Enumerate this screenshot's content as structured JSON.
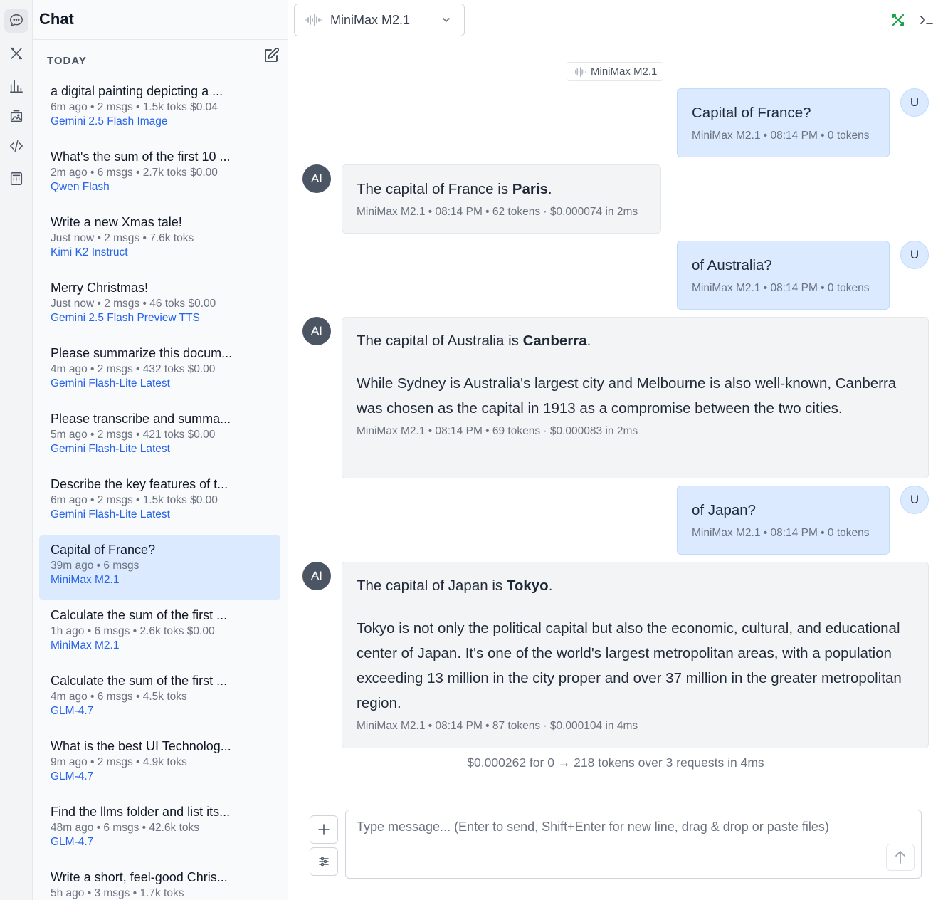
{
  "rail": {
    "items": [
      "chat-icon",
      "tools-icon",
      "bar-chart-icon",
      "image-gallery-icon",
      "code-icon",
      "calculator-icon"
    ]
  },
  "sidebar": {
    "title": "Chat",
    "section": "TODAY",
    "conversations": [
      {
        "title": "a digital painting depicting a ...",
        "meta": "6m ago • 2 msgs • 1.5k toks $0.04",
        "model": "Gemini 2.5 Flash Image"
      },
      {
        "title": "What's the sum of the first 10 ...",
        "meta": "2m ago • 6 msgs • 2.7k toks $0.00",
        "model": "Qwen Flash"
      },
      {
        "title": "Write a new Xmas tale!",
        "meta": "Just now • 2 msgs • 7.6k toks",
        "model": "Kimi K2 Instruct"
      },
      {
        "title": "Merry Christmas!",
        "meta": "Just now • 2 msgs • 46 toks $0.00",
        "model": "Gemini 2.5 Flash Preview TTS"
      },
      {
        "title": "Please summarize this docum...",
        "meta": "4m ago • 2 msgs • 432 toks $0.00",
        "model": "Gemini Flash-Lite Latest"
      },
      {
        "title": "Please transcribe and summa...",
        "meta": "5m ago • 2 msgs • 421 toks $0.00",
        "model": "Gemini Flash-Lite Latest"
      },
      {
        "title": "Describe the key features of t...",
        "meta": "6m ago • 2 msgs • 1.5k toks $0.00",
        "model": "Gemini Flash-Lite Latest"
      },
      {
        "title": "Capital of France?",
        "meta": "39m ago • 6 msgs",
        "model": "MiniMax M2.1",
        "selected": true
      },
      {
        "title": "Calculate the sum of the first ...",
        "meta": "1h ago • 6 msgs • 2.6k toks $0.00",
        "model": "MiniMax M2.1"
      },
      {
        "title": "Calculate the sum of the first ...",
        "meta": "4m ago • 6 msgs • 4.5k toks",
        "model": "GLM-4.7"
      },
      {
        "title": "What is the best UI Technolog...",
        "meta": "9m ago • 2 msgs • 4.9k toks",
        "model": "GLM-4.7"
      },
      {
        "title": "Find the llms folder and list its...",
        "meta": "48m ago • 6 msgs • 42.6k toks",
        "model": "GLM-4.7"
      },
      {
        "title": "Write a short, feel-good Chris...",
        "meta": "5h ago • 3 msgs • 1.7k toks",
        "model": ""
      }
    ]
  },
  "header": {
    "model_label": "MiniMax M2.1",
    "pill_label": "MiniMax M2.1",
    "accent_color": "#16a34a"
  },
  "messages": {
    "user_avatar": "U",
    "ai_avatar": "AI",
    "m1": {
      "text": "Capital of France?",
      "meta": "MiniMax M2.1 • 08:14 PM • 0 tokens"
    },
    "m2": {
      "pre": "The capital of France is ",
      "bold": "Paris",
      "post": ".",
      "meta": "MiniMax M2.1 • 08:14 PM • 62 tokens · $0.000074 in 2ms"
    },
    "m3": {
      "text": "of Australia?",
      "meta": "MiniMax M2.1 • 08:14 PM • 0 tokens"
    },
    "m4": {
      "pre": "The capital of Australia is ",
      "bold": "Canberra",
      "post": ".",
      "para": "While Sydney is Australia's largest city and Melbourne is also well-known, Canberra was chosen as the capital in 1913 as a compromise between the two cities.",
      "meta": "MiniMax M2.1 • 08:14 PM • 69 tokens · $0.000083 in 2ms"
    },
    "m5": {
      "text": "of Japan?",
      "meta": "MiniMax M2.1 • 08:14 PM • 0 tokens"
    },
    "m6": {
      "pre": "The capital of Japan is ",
      "bold": "Tokyo",
      "post": ".",
      "para": "Tokyo is not only the political capital but also the economic, cultural, and educational center of Japan. It's one of the world's largest metropolitan areas, with a population exceeding 13 million in the city proper and over 37 million in the greater metropolitan region.",
      "meta": "MiniMax M2.1 • 08:14 PM • 87 tokens · $0.000104 in 4ms"
    }
  },
  "summary": "$0.000262 for 0 → 218 tokens over 3 requests in 4ms",
  "composer": {
    "placeholder": "Type message... (Enter to send, Shift+Enter for new line, drag & drop or paste files)"
  }
}
